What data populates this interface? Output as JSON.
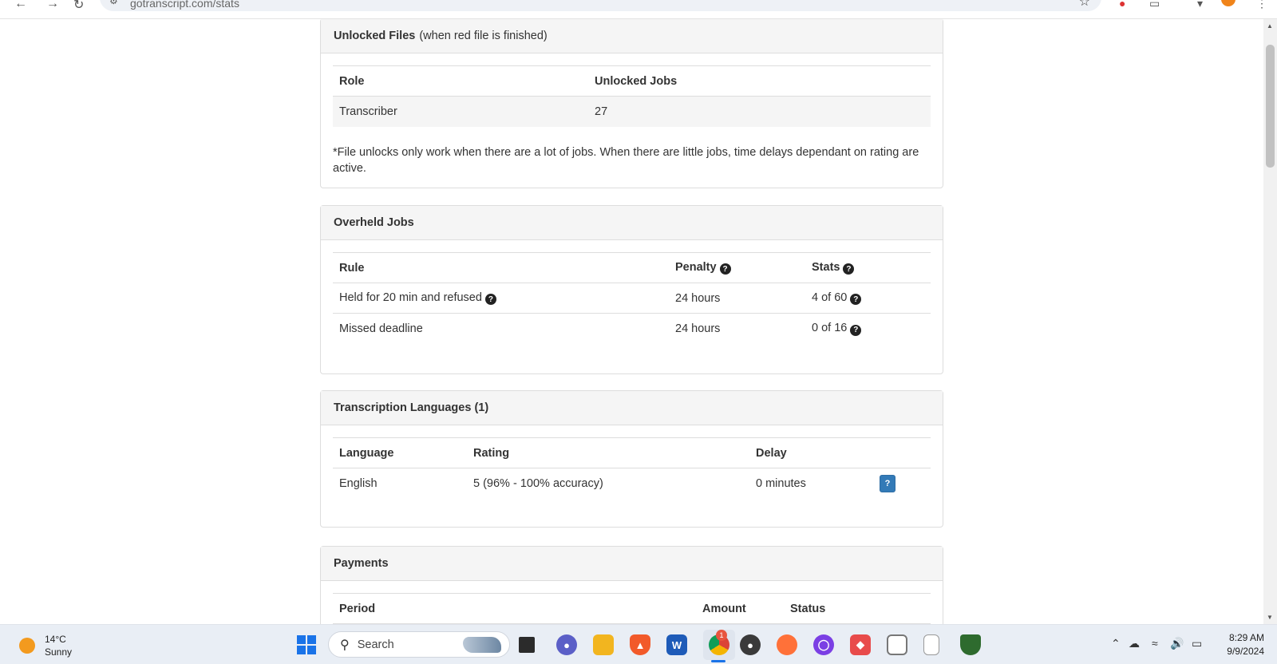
{
  "browser": {
    "url": "gotranscript.com/stats"
  },
  "unlocked": {
    "title": "Unlocked Files",
    "subtitle": "(when red file is finished)",
    "columns": [
      "Role",
      "Unlocked Jobs"
    ],
    "rows": [
      [
        "Transcriber",
        "27"
      ]
    ],
    "note": "*File unlocks only work when there are a lot of jobs. When there are little jobs, time delays dependant on rating are active."
  },
  "overheld": {
    "title": "Overheld Jobs",
    "columns": [
      "Rule",
      "Penalty",
      "Stats"
    ],
    "rows": [
      [
        "Held for 20 min and refused",
        "24 hours",
        "4 of 60"
      ],
      [
        "Missed deadline",
        "24 hours",
        "0 of 16"
      ]
    ]
  },
  "languages": {
    "title": "Transcription Languages (1)",
    "columns": [
      "Language",
      "Rating",
      "Delay"
    ],
    "rows": [
      [
        "English",
        "5 (96% - 100% accuracy)",
        "0 minutes"
      ]
    ],
    "help_label": "?"
  },
  "payments": {
    "title": "Payments",
    "columns": [
      "Period",
      "Amount",
      "Status"
    ]
  },
  "taskbar": {
    "weather_temp": "14°C",
    "weather_desc": "Sunny",
    "search_label": "Search",
    "chrome_badge": "1",
    "time": "8:29 AM",
    "date": "9/9/2024"
  },
  "colors": {
    "link_blue": "#337ab7",
    "panel_heading_bg": "#f5f5f5",
    "border": "#dddddd"
  }
}
